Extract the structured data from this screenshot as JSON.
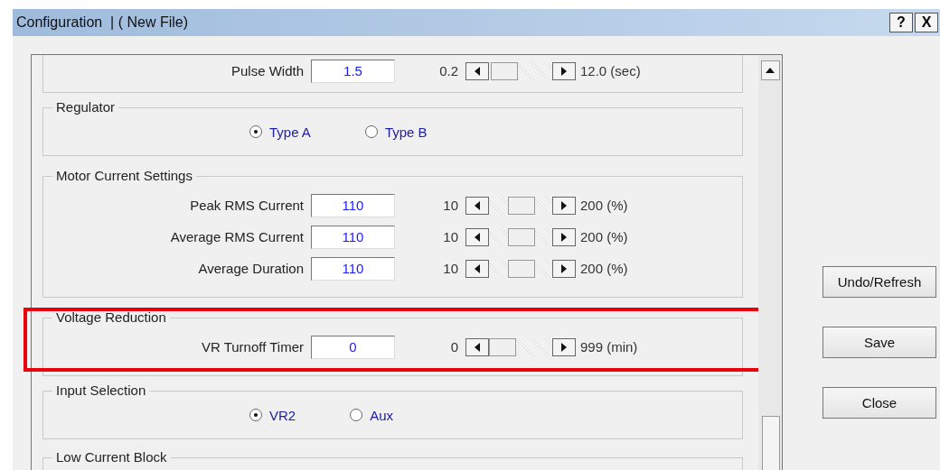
{
  "window": {
    "title": "Configuration  | ( New File)",
    "help_button": "?",
    "close_button": "X"
  },
  "sections": [
    {
      "kind": "sliders",
      "highlighted": false,
      "rows": [
        {
          "label": "Pulse Width",
          "value": "1.5",
          "min": "0.2",
          "max": "12.0 (sec)",
          "level": 0.05
        }
      ]
    },
    {
      "kind": "radios",
      "title": "Regulator",
      "highlighted": false,
      "options": [
        {
          "label": "Type A",
          "selected": true
        },
        {
          "label": "Type B",
          "selected": false
        }
      ]
    },
    {
      "kind": "sliders",
      "title": "Motor Current Settings",
      "highlighted": false,
      "rows": [
        {
          "label": "Peak RMS Current",
          "value": "110",
          "min": "10",
          "max": "200 (%)",
          "level": 0.5
        },
        {
          "label": "Average RMS Current",
          "value": "110",
          "min": "10",
          "max": "200 (%)",
          "level": 0.5
        },
        {
          "label": "Average Duration",
          "value": "110",
          "min": "10",
          "max": "200 (%)",
          "level": 0.5
        }
      ]
    },
    {
      "kind": "sliders",
      "title": "Voltage Reduction",
      "highlighted": true,
      "rows": [
        {
          "label": "VR Turnoff Timer",
          "value": "0",
          "min": "0",
          "max": "999 (min)",
          "level": 0
        }
      ]
    },
    {
      "kind": "radios",
      "title": "Input Selection",
      "highlighted": false,
      "options": [
        {
          "label": "VR2",
          "selected": true
        },
        {
          "label": "Aux",
          "selected": false
        }
      ]
    },
    {
      "kind": "empty",
      "title": "Low Current Block",
      "highlighted": false
    }
  ],
  "buttons": [
    "Undo/Refresh",
    "Save",
    "Close"
  ]
}
